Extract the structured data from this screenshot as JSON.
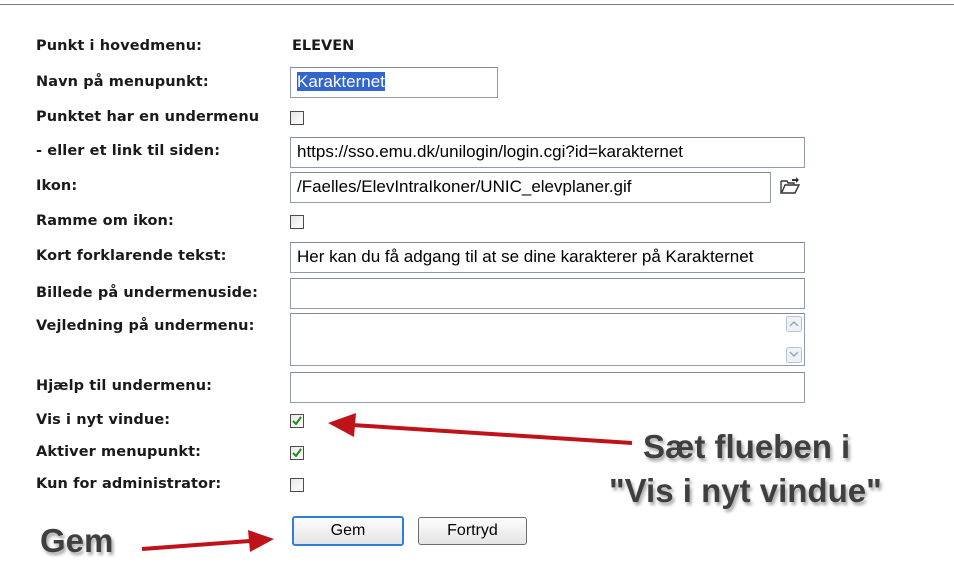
{
  "form": {
    "rows": [
      {
        "label": "Punkt i hovedmenu:",
        "value": "ELEVEN"
      },
      {
        "label": "Navn på menupunkt:",
        "value": "Karakternet"
      },
      {
        "label": "Punktet har en undermenu",
        "checked": false
      },
      {
        "label": "- eller et link til siden:",
        "value": "https://sso.emu.dk/unilogin/login.cgi?id=karakternet"
      },
      {
        "label": "Ikon:",
        "value": "/Faelles/ElevIntraIkoner/UNIC_elevplaner.gif"
      },
      {
        "label": "Ramme om ikon:",
        "checked": false
      },
      {
        "label": "Kort forklarende tekst:",
        "value": "Her kan du få adgang til at se dine karakterer på Karakternet"
      },
      {
        "label": "Billede på undermenuside:",
        "value": ""
      },
      {
        "label": "Vejledning på undermenu:",
        "value": ""
      },
      {
        "label": "Hjælp til undermenu:",
        "value": ""
      },
      {
        "label": "Vis i nyt vindue:",
        "checked": true
      },
      {
        "label": "Aktiver menupunkt:",
        "checked": true
      },
      {
        "label": "Kun for administrator:",
        "checked": false
      }
    ]
  },
  "buttons": {
    "save": "Gem",
    "cancel": "Fortryd"
  },
  "annotations": {
    "callout_line1": "Sæt flueben i",
    "callout_line2": "\"Vis i nyt vindue\"",
    "save_hint": "Gem",
    "arrow_color": "#c0121a"
  },
  "icons": {
    "browse": "folder-open-icon"
  }
}
